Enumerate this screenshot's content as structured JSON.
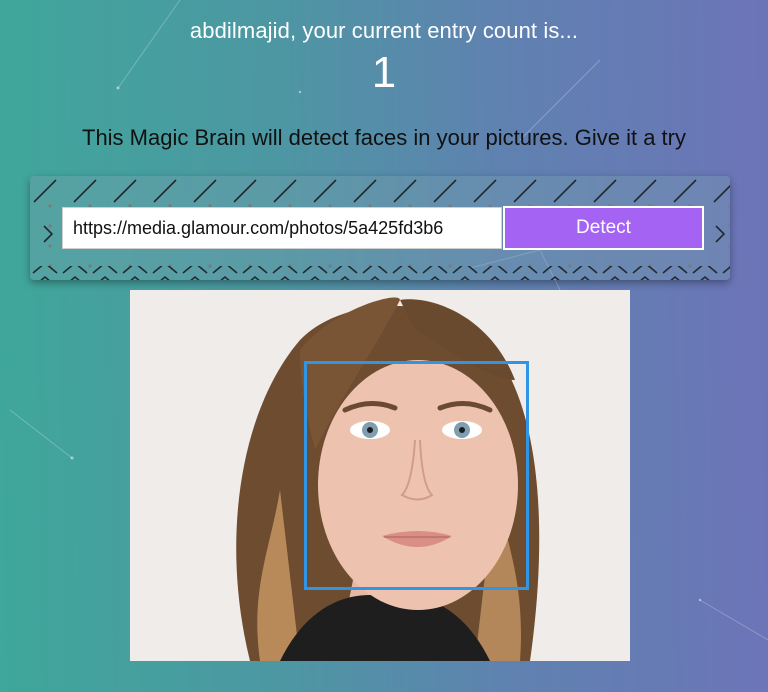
{
  "header": {
    "greeting": "abdilmajid, your current entry count is...",
    "entry_count": "1"
  },
  "tagline": "This Magic Brain will detect faces in your pictures. Give it a try",
  "form": {
    "url_value": "https://media.glamour.com/photos/5a425fd3b6",
    "detect_label": "Detect"
  },
  "image": {
    "description_icon": "portrait-photo",
    "face_detected": true
  },
  "colors": {
    "button": "#a463f2",
    "face_box": "#2f95e6",
    "gradient_start": "#3fa79b",
    "gradient_end": "#6c74b8"
  }
}
